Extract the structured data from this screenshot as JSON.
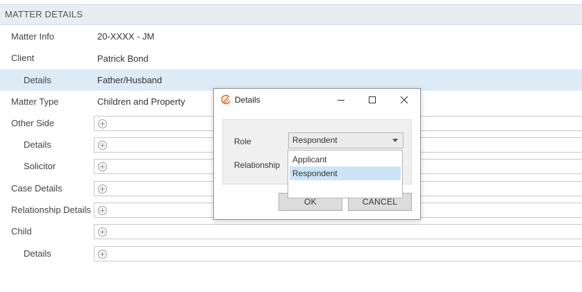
{
  "header": {
    "title": "MATTER DETAILS"
  },
  "rows": [
    {
      "label": "Matter Info",
      "value": "20-XXXX - JM"
    },
    {
      "label": "Client",
      "value": "Patrick Bond"
    },
    {
      "label": "Details",
      "value": "Father/Husband"
    },
    {
      "label": "Matter Type",
      "value": "Children and Property"
    },
    {
      "label": "Other Side"
    },
    {
      "label": "Details"
    },
    {
      "label": "Solicitor"
    },
    {
      "label": "Case Details"
    },
    {
      "label": "Relationship Details"
    },
    {
      "label": "Child"
    },
    {
      "label": "Details"
    }
  ],
  "dialog": {
    "title": "Details",
    "role_label": "Role",
    "role_value": "Respondent",
    "relationship_label": "Relationship",
    "options": [
      "Applicant",
      "Respondent"
    ],
    "selected_option": "Respondent",
    "ok_label": "OK",
    "cancel_label": "CANCEL"
  },
  "colors": {
    "accent_logo": "#e8742a",
    "header_bg": "#e8edf2",
    "row_highlight": "#ddebf7",
    "option_selected": "#cce4f7"
  }
}
